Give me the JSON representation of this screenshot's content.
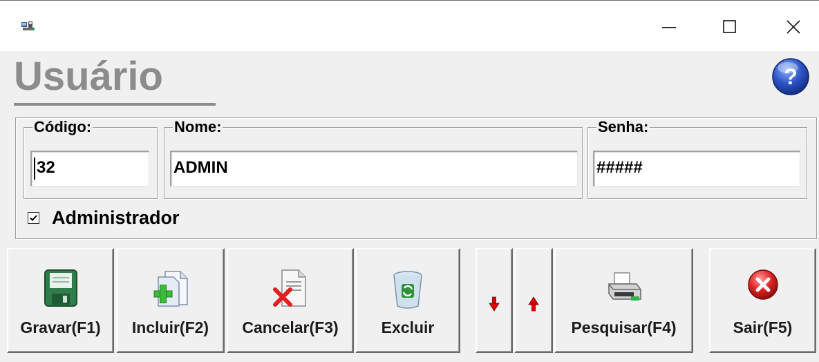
{
  "window": {
    "title": "",
    "minimize_label": "Minimize",
    "maximize_label": "Maximize",
    "close_label": "Close"
  },
  "header": {
    "title": "Usuário"
  },
  "form": {
    "codigo": {
      "label": "Código:",
      "value": "32"
    },
    "nome": {
      "label": "Nome:",
      "value": "ADMIN"
    },
    "senha": {
      "label": "Senha:",
      "value": "#####"
    },
    "administrador": {
      "label": "Administrador",
      "checked": true
    }
  },
  "toolbar": {
    "gravar": "Gravar(F1)",
    "incluir": "Incluir(F2)",
    "cancelar": "Cancelar(F3)",
    "excluir": "Excluir",
    "pesquisar": "Pesquisar(F4)",
    "sair": "Sair(F5)"
  },
  "icons": {
    "app": "app-icon",
    "help": "help-icon",
    "gravar": "floppy-disk-icon",
    "incluir": "add-document-icon",
    "cancelar": "delete-document-icon",
    "excluir": "recycle-bin-icon",
    "down": "arrow-down-icon",
    "up": "arrow-up-icon",
    "pesquisar": "printer-search-icon",
    "sair": "exit-icon"
  },
  "colors": {
    "background": "#f0f0f0",
    "title_gray": "#8c8c8c",
    "help_blue": "#2a4db8",
    "arrow_red": "#e00000",
    "exit_red": "#d81818",
    "floppy_green": "#2e7d4a"
  }
}
